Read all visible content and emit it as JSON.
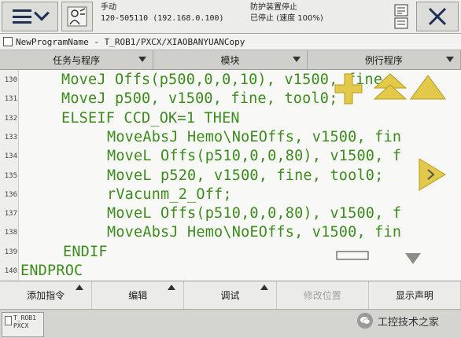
{
  "header": {
    "menu_label": "ABB menu",
    "status_line1_left": "手动",
    "status_line2_left": "120-505110 (192.168.0.100)",
    "status_line1_right": "防护装置停止",
    "status_line2_right": "已停止 (速度 100%)"
  },
  "titlebar": {
    "text": "NewProgramName - T_ROB1/PXCX/XIAOBANYUANCopy"
  },
  "tabs": [
    {
      "label": "任务与程序"
    },
    {
      "label": "模块"
    },
    {
      "label": "例行程序"
    }
  ],
  "editor": {
    "lines": [
      {
        "num": "130",
        "code": "MoveJ Offs(p500,0,0,10), v1500, fine,",
        "indent": 78
      },
      {
        "num": "131",
        "code": "MoveJ p500, v1500, fine, tool0;",
        "indent": 78
      },
      {
        "num": "132",
        "code": "ELSEIF CCD_OK=1 THEN",
        "indent": 78
      },
      {
        "num": "133",
        "code": "MoveAbsJ Hemo\\NoEOffs, v1500, fin",
        "indent": 136
      },
      {
        "num": "134",
        "code": "MoveL Offs(p510,0,0,80), v1500, f",
        "indent": 136
      },
      {
        "num": "135",
        "code": "MoveL p520, v1500, fine, tool0;",
        "indent": 136
      },
      {
        "num": "136",
        "code": "rVacunm_2_Off;",
        "indent": 136
      },
      {
        "num": "137",
        "code": "MoveL Offs(p510,0,0,80), v1500, f",
        "indent": 136
      },
      {
        "num": "138",
        "code": "MoveAbsJ Hemo\\NoEOffs, v1500, fin",
        "indent": 136
      },
      {
        "num": "139",
        "code": "ENDIF",
        "indent": 80
      },
      {
        "num": "140",
        "code": "ENDPROC",
        "indent": 26
      }
    ]
  },
  "bottom_buttons": [
    {
      "label": "添加指令",
      "disabled": false,
      "arrow": true
    },
    {
      "label": "编辑",
      "disabled": false,
      "arrow": true
    },
    {
      "label": "调试",
      "disabled": false,
      "arrow": true
    },
    {
      "label": "修改位置",
      "disabled": true,
      "arrow": false
    },
    {
      "label": "显示声明",
      "disabled": false,
      "arrow": false
    }
  ],
  "taskbar": {
    "task_line1": "T_ROB1",
    "task_line2": "PXCX"
  },
  "watermark": {
    "text": "工控技术之家"
  },
  "colors": {
    "code_green": "#3d8b1e",
    "nav_arrow_yellow": "#e2c94a"
  }
}
